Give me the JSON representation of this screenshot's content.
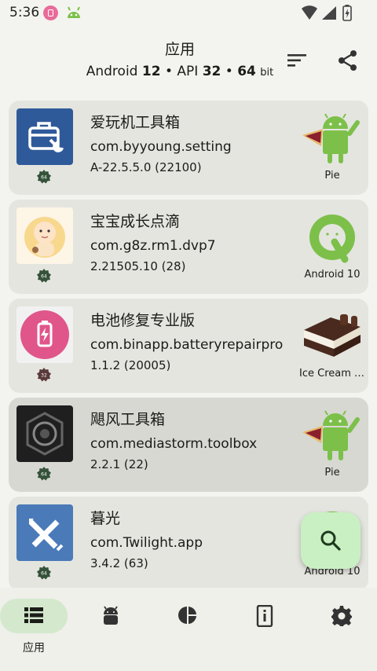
{
  "status_bar": {
    "time": "5:36"
  },
  "header": {
    "title": "应用",
    "subtitle": {
      "os": "Android",
      "os_version": "12",
      "api_prefix": "API",
      "api_level": "32",
      "bits": "64",
      "bits_unit": "bit"
    }
  },
  "apps": [
    {
      "name": "爱玩机工具箱",
      "package": "com.byyoung.setting",
      "version": "A-22.5.5.0 (22100)",
      "abi": "64",
      "target_label": "Pie",
      "icon": "toolbox-icon",
      "target_icon": "android-pie-icon",
      "icon_color": "#2f5a9a"
    },
    {
      "name": "宝宝成长点滴",
      "package": "com.g8z.rm1.dvp7",
      "version": "2.21505.10 (28)",
      "abi": "64",
      "target_label": "Android 10",
      "icon": "baby-icon",
      "target_icon": "android-q-icon",
      "icon_color": "#f7d88d"
    },
    {
      "name": "电池修复专业版",
      "package": "com.binapp.batteryrepairpro",
      "version": "1.1.2 (20005)",
      "abi": "32",
      "target_label": "Ice Cream Sandwich",
      "icon": "battery-icon",
      "target_icon": "ice-cream-sandwich-icon",
      "icon_color": "#e0568a"
    },
    {
      "name": "飓风工具箱",
      "package": "com.mediastorm.toolbox",
      "version": "2.2.1 (22)",
      "abi": "64",
      "target_label": "Pie",
      "icon": "lens-icon",
      "target_icon": "android-pie-icon",
      "icon_color": "#1f1f1f"
    },
    {
      "name": "暮光",
      "package": "com.Twilight.app",
      "version": "3.4.2 (63)",
      "abi": "64",
      "target_label": "Android 10",
      "icon": "pencil-ruler-icon",
      "target_icon": "android-q-icon",
      "icon_color": "#4a7ab8"
    }
  ],
  "bottom_nav": {
    "items": [
      {
        "label": "应用",
        "icon": "app-list-icon",
        "active": true
      },
      {
        "label": "",
        "icon": "android-head-icon",
        "active": false
      },
      {
        "label": "",
        "icon": "pie-chart-icon",
        "active": false
      },
      {
        "label": "",
        "icon": "device-info-icon",
        "active": false
      },
      {
        "label": "",
        "icon": "gear-icon",
        "active": false
      }
    ]
  },
  "colors": {
    "background": "#f3f4ef",
    "card": "#e4e5df",
    "card_selected": "#d7d8d2",
    "fab": "#c9f0c2",
    "nav_active": "#d4e8cd",
    "android_green": "#7cc04a"
  }
}
